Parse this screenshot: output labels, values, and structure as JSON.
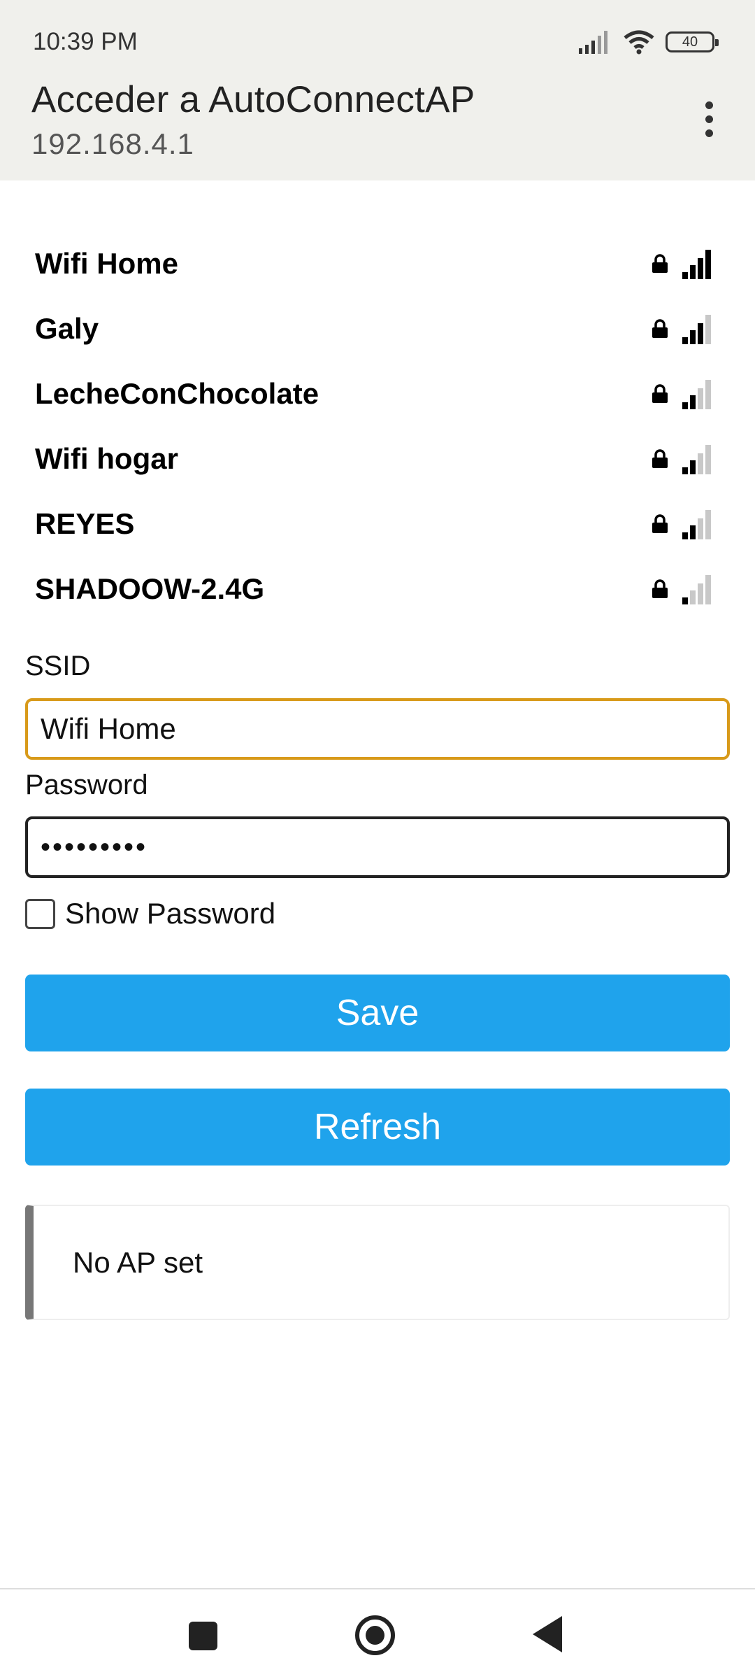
{
  "status_bar": {
    "time": "10:39 PM",
    "battery": "40",
    "icons": [
      "signal-icon",
      "wifi-icon",
      "battery-icon"
    ]
  },
  "header": {
    "title": "Acceder a AutoConnectAP",
    "subtitle": "192.168.4.1",
    "menu_icon": "more-vert-icon"
  },
  "networks": [
    {
      "name": "Wifi Home",
      "locked": true,
      "signal": 4
    },
    {
      "name": "Galy",
      "locked": true,
      "signal": 3
    },
    {
      "name": "LecheConChocolate",
      "locked": true,
      "signal": 2
    },
    {
      "name": "Wifi hogar",
      "locked": true,
      "signal": 2
    },
    {
      "name": "REYES",
      "locked": true,
      "signal": 2
    },
    {
      "name": "SHADOOW-2.4G",
      "locked": true,
      "signal": 1
    }
  ],
  "form": {
    "ssid_label": "SSID",
    "ssid_value": "Wifi Home",
    "password_label": "Password",
    "password_value": "•••••••••",
    "show_password_label": "Show Password",
    "show_password_checked": false
  },
  "buttons": {
    "save": "Save",
    "refresh": "Refresh"
  },
  "message": "No AP set",
  "colors": {
    "accent": "#1fa3ec",
    "focus_border": "#d89a1a",
    "header_bg": "#f0f0ec"
  }
}
